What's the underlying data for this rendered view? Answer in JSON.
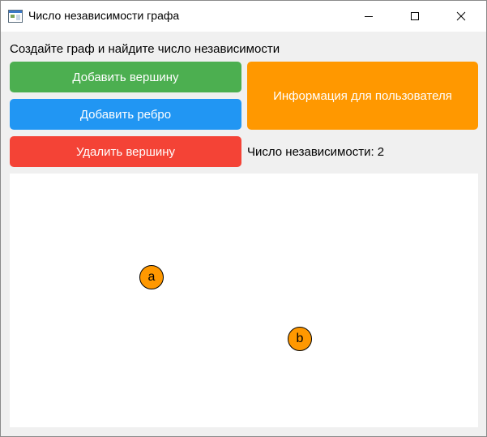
{
  "window": {
    "title": "Число независимости графа"
  },
  "main": {
    "prompt": "Создайте граф и найдите число независимости",
    "buttons": {
      "add_vertex": "Добавить вершину",
      "add_edge": "Добавить ребро",
      "delete_vertex": "Удалить вершину",
      "info": "Информация для пользователя"
    },
    "independence_label": "Число независимости: 2"
  },
  "graph": {
    "vertices": [
      {
        "label": "a"
      },
      {
        "label": "b"
      }
    ],
    "edges": []
  },
  "colors": {
    "add_vertex": "#4caf50",
    "add_edge": "#2196f3",
    "delete_vertex": "#f44336",
    "info": "#ff9800",
    "vertex_fill": "#ff9800"
  },
  "icons": {
    "app": "app-window-icon",
    "minimize": "minimize-icon",
    "maximize": "maximize-icon",
    "close": "close-icon"
  }
}
